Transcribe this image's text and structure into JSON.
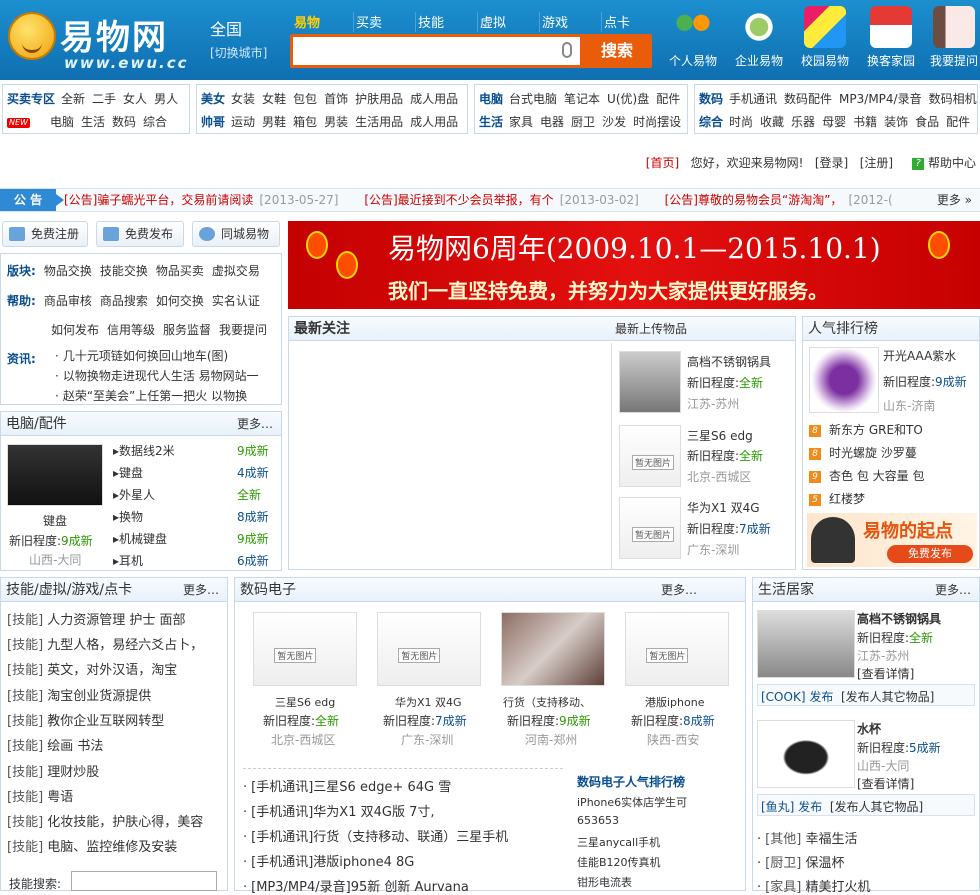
{
  "header": {
    "logo_text": "易物网",
    "logo_domain": "www.ewu.cc",
    "city": "全国",
    "city_switch": "[切换城市]",
    "search_tabs": [
      "易物",
      "买卖",
      "技能",
      "虚拟",
      "游戏",
      "点卡"
    ],
    "search_button": "搜索",
    "nav": [
      "个人易物",
      "企业易物",
      "校园易物",
      "换客家园",
      "我要提问"
    ]
  },
  "categories": [
    {
      "rows": [
        {
          "label": "买卖专区",
          "items": [
            "全新",
            "二手",
            "女人",
            "男人"
          ]
        },
        {
          "badge": "NEW",
          "items": [
            "电脑",
            "生活",
            "数码",
            "综合"
          ]
        }
      ]
    },
    {
      "rows": [
        {
          "label": "美女",
          "items": [
            "女装",
            "女鞋",
            "包包",
            "首饰",
            "护肤用品",
            "成人用品"
          ]
        },
        {
          "label": "帅哥",
          "items": [
            "运动",
            "男鞋",
            "箱包",
            "男装",
            "生活用品",
            "成人用品"
          ]
        }
      ]
    },
    {
      "rows": [
        {
          "label": "电脑",
          "items": [
            "台式电脑",
            "笔记本",
            "U(优)盘",
            "配件"
          ]
        },
        {
          "label": "生活",
          "items": [
            "家具",
            "电器",
            "厨卫",
            "沙发",
            "时尚摆设"
          ]
        }
      ]
    },
    {
      "rows": [
        {
          "label": "数码",
          "items": [
            "手机通讯",
            "数码配件",
            "MP3/MP4/录音",
            "数码相机"
          ]
        },
        {
          "label": "综合",
          "items": [
            "时尚",
            "收藏",
            "乐器",
            "母婴",
            "书籍",
            "装饰",
            "食品",
            "配件"
          ]
        }
      ]
    }
  ],
  "toplinks": {
    "home": "[首页]",
    "welcome": "您好，欢迎来易物网!",
    "login": "[登录]",
    "register": "[注册]",
    "help": "帮助中心"
  },
  "notice": {
    "label": "公 告",
    "items": [
      {
        "text": "[公告]骗子蠕光平台，交易前请阅读",
        "date": "[2013-05-27]"
      },
      {
        "text": "[公告]最近接到不少会员举报，有个",
        "date": "[2013-03-02]"
      },
      {
        "text": "[公告]尊敬的易物会员“游淘淘”，",
        "date": "[2012-("
      }
    ],
    "more": "更多"
  },
  "quick": [
    "免费注册",
    "免费发布",
    "同城易物"
  ],
  "board": {
    "bk_label": "版块:",
    "bk": [
      "物品交换",
      "技能交换",
      "物品买卖",
      "虚拟交易"
    ],
    "help_label": "帮助:",
    "help1": [
      "商品审核",
      "商品搜索",
      "如何交换",
      "实名认证"
    ],
    "help2": [
      "如何发布",
      "信用等级",
      "服务监督",
      "我要提问"
    ],
    "news_label": "资讯:",
    "news": [
      "几十元项链如何换回山地车(图)",
      "以物换物走进现代人生活 易物网站一",
      "赵荣“至美会”上任第一把火 以物换"
    ]
  },
  "banner": {
    "line1": "易物网6周年(2009.10.1—2015.10.1)",
    "line2": "我们一直坚持免费，并努力为大家提供更好服务。"
  },
  "pc": {
    "title": "电脑/配件",
    "more": "更多…",
    "feat_name": "键盘",
    "feat_cond": "新旧程度:",
    "feat_val": "9成新",
    "feat_loc": "山西-大同",
    "list": [
      {
        "n": "数据线2米",
        "v": "9成新"
      },
      {
        "n": "键盘",
        "v": "4成新"
      },
      {
        "n": "外星人",
        "v": "全新"
      },
      {
        "n": "换物",
        "v": "8成新"
      },
      {
        "n": "机械键盘",
        "v": "9成新"
      },
      {
        "n": "耳机",
        "v": "6成新"
      }
    ]
  },
  "latest": {
    "title": "最新关注",
    "sub": "最新上传物品",
    "items": [
      {
        "n": "高档不锈钢锅具",
        "c": "新旧程度:",
        "v": "全新",
        "l": "江苏-苏州"
      },
      {
        "n": "三星S6 edg",
        "c": "新旧程度:",
        "v": "全新",
        "l": "北京-西城区"
      },
      {
        "n": "华为X1 双4G",
        "c": "新旧程度:",
        "v": "7成新",
        "l": "广东-深圳"
      }
    ]
  },
  "rank": {
    "title": "人气排行榜",
    "top_name": "开光AAA紫水",
    "top_cond": "新旧程度:",
    "top_val": "9成新",
    "top_loc": "山东-济南",
    "list": [
      "新东方 GRE和TO",
      "时光螺旋 沙罗蔓",
      "杏色 包 大容量 包",
      "红楼梦"
    ],
    "nums": [
      "8",
      "8",
      "9",
      "5"
    ],
    "ad1": "易物的起点",
    "ad2": "免费发布"
  },
  "skills": {
    "title": "技能/虚拟/游戏/点卡",
    "more": "更多…",
    "tag": "[技能]",
    "items": [
      "人力资源管理 护士 面部",
      "九型人格，易经六爻占卜，",
      "英文，对外汉语，淘宝",
      "淘宝创业货源提供",
      "教你企业互联网转型",
      "绘画 书法",
      "理财炒股",
      "粤语",
      "化妆技能，护肤心得，美容",
      "电脑、监控维修及安装"
    ],
    "search_label": "技能搜索:"
  },
  "digital": {
    "title": "数码电子",
    "more": "更多…",
    "cards": [
      {
        "n": "三星S6 edg",
        "c": "新旧程度:",
        "v": "全新",
        "l": "北京-西城区"
      },
      {
        "n": "华为X1 双4G",
        "c": "新旧程度:",
        "v": "7成新",
        "l": "广东-深圳"
      },
      {
        "n": "行货（支持移动、",
        "c": "新旧程度:",
        "v": "9成新",
        "l": "河南-郑州"
      },
      {
        "n": "港版iphone",
        "c": "新旧程度:",
        "v": "8成新",
        "l": "陕西-西安"
      }
    ],
    "news": [
      "[手机通讯]三星S6 edge+ 64G 雪",
      "[手机通讯]华为X1 双4G版 7寸,",
      "[手机通讯]行货（支持移动、联通）三星手机",
      "[手机通讯]港版iphone4 8G",
      "[MP3/MP4/录音]95新 创新 Aurvana"
    ],
    "rank_title": "数码电子人气排行榜",
    "rank": [
      "iPhone6实体店学生可",
      "653653",
      "三星anycall手机",
      "佳能B120传真机",
      "钳形电流表"
    ]
  },
  "life": {
    "title": "生活居家",
    "more": "更多…",
    "items": [
      {
        "n": "高档不锈钢锅具",
        "c": "新旧程度:",
        "v": "全新",
        "l": "江苏-苏州",
        "d": "[查看详情]",
        "u": "[COOK] 发布",
        "o": "[发布人其它物品]"
      },
      {
        "n": "水杯",
        "c": "新旧程度:",
        "v": "5成新",
        "l": "山西-大同",
        "d": "[查看详情]",
        "u": "[鱼丸] 发布",
        "o": "[发布人其它物品]"
      }
    ],
    "list": [
      {
        "t": "[其他]",
        "n": "幸福生活"
      },
      {
        "t": "[厨卫]",
        "n": "保温杯"
      },
      {
        "t": "[家具]",
        "n": "精美打火机"
      }
    ]
  }
}
